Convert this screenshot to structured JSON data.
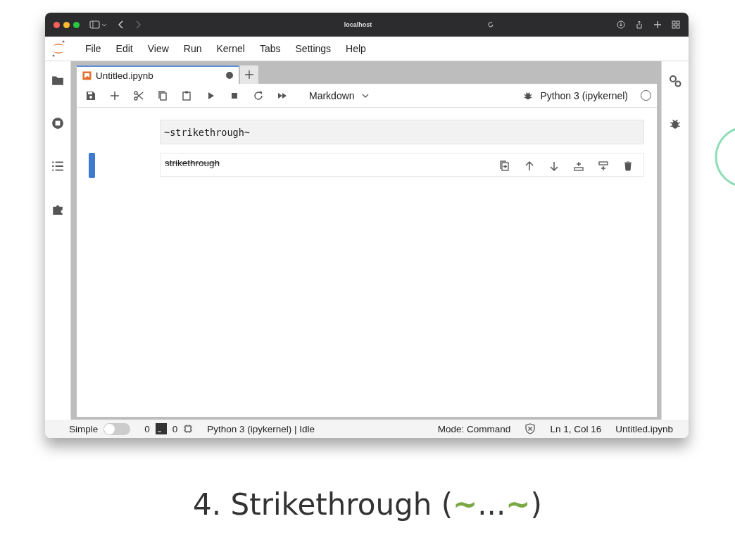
{
  "browser": {
    "address": "localhost"
  },
  "menu": [
    "File",
    "Edit",
    "View",
    "Run",
    "Kernel",
    "Tabs",
    "Settings",
    "Help"
  ],
  "tabs": [
    {
      "label": "Untitled.ipynb",
      "selected": true,
      "dirty": true
    }
  ],
  "toolbar": {
    "cell_type": "Markdown",
    "kernel": "Python 3 (ipykernel)",
    "kernel_busy": false
  },
  "cells": [
    {
      "kind": "editor",
      "source": "~strikethrough~",
      "active": false
    },
    {
      "kind": "rendered",
      "text": "strikethrough",
      "struck": true,
      "active": true
    }
  ],
  "status_bar": {
    "mode_label": "Simple",
    "simple_on": false,
    "terminals": "0",
    "kernels": "0",
    "kernel_status": "Python 3 (ipykernel) | Idle",
    "mode": "Mode: Command",
    "position": "Ln 1, Col 16",
    "file": "Untitled.ipynb"
  },
  "caption": {
    "before": "4. Strikethrough (",
    "open_mark": "~",
    "middle": "...",
    "close_mark": "~",
    "after": ")"
  }
}
